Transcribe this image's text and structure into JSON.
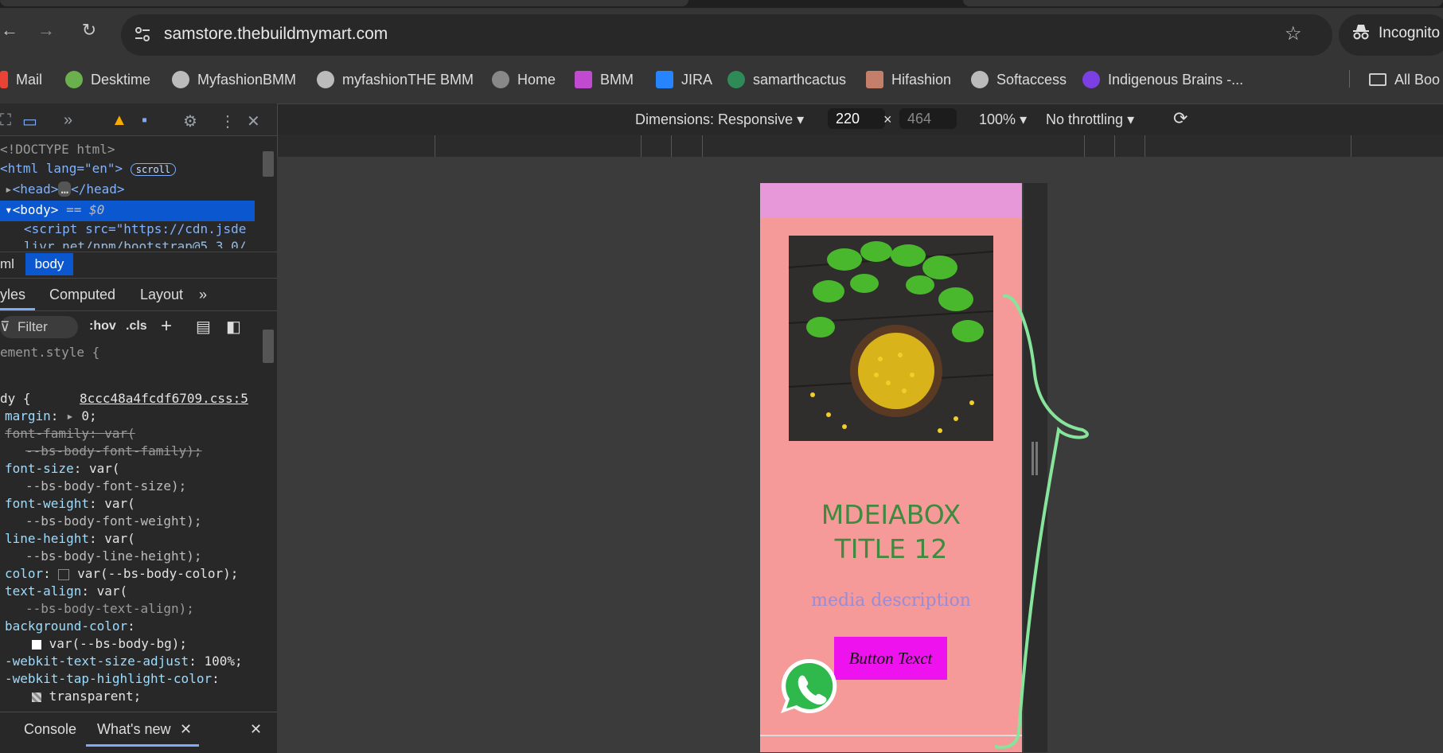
{
  "browser": {
    "url": "samstore.thebuildmymart.com",
    "profile_label": "Incognito",
    "bookmarks": [
      {
        "label": "Mail",
        "icon": "gmail-icon",
        "color": "#ea4335"
      },
      {
        "label": "Desktime",
        "icon": "desktime-icon",
        "color": "#6ab04c"
      },
      {
        "label": "MyfashionBMM",
        "icon": "globe-icon",
        "color": "#bbbbbb"
      },
      {
        "label": "myfashionTHE BMM",
        "icon": "globe-icon",
        "color": "#bbbbbb"
      },
      {
        "label": "Home",
        "icon": "globe-icon",
        "color": "#888888"
      },
      {
        "label": "BMM",
        "icon": "bmm-icon",
        "color": "#c04bd0"
      },
      {
        "label": "JIRA",
        "icon": "jira-icon",
        "color": "#2684ff"
      },
      {
        "label": "samarthcactus",
        "icon": "cactus-icon",
        "color": "#2e8b57"
      },
      {
        "label": "Hifashion",
        "icon": "hifashion-icon",
        "color": "#c47e6a"
      },
      {
        "label": "Softaccess",
        "icon": "globe-icon",
        "color": "#bbbbbb"
      },
      {
        "label": "Indigenous Brains -...",
        "icon": "indigenous-icon",
        "color": "#7b3fe4"
      }
    ],
    "all_bookmarks_label": "All Boo"
  },
  "devtools": {
    "dom": {
      "doctype": "<!DOCTYPE html>",
      "html_open": "<html lang=\"en\">",
      "scroll_badge": "scroll",
      "head": "<head>",
      "head_close": "</head>",
      "body": "<body>",
      "body_eq": "== $0",
      "script_line": "<script src=\"https://cdn.jsde",
      "script_line2": "livr.net/npm/bootstrap@5.3.0/"
    },
    "breadcrumbs": [
      "ml",
      "body"
    ],
    "style_tabs": [
      "yles",
      "Computed",
      "Layout"
    ],
    "filter_placeholder": "Filter",
    "filter_tools": [
      ":hov",
      ".cls"
    ],
    "rules": {
      "element_style": "ement.style {",
      "body_selector": "dy {",
      "source": "8ccc48a4fcdf6709.css:5",
      "lines": [
        {
          "prop": "margin",
          "value": "0;"
        },
        {
          "prop": "font-family",
          "value": "var(",
          "struck": true
        },
        {
          "prop": "",
          "value": "--bs-body-font-family);",
          "struck": true
        },
        {
          "prop": "font-size",
          "value": "var("
        },
        {
          "prop": "",
          "value": "--bs-body-font-size);"
        },
        {
          "prop": "font-weight",
          "value": "var("
        },
        {
          "prop": "",
          "value": "--bs-body-font-weight);"
        },
        {
          "prop": "line-height",
          "value": "var("
        },
        {
          "prop": "",
          "value": "--bs-body-line-height);"
        },
        {
          "prop": "color",
          "value": "var(--bs-body-color);"
        },
        {
          "prop": "text-align",
          "value": "var("
        },
        {
          "prop": "",
          "value": "--bs-body-text-align);"
        },
        {
          "prop": "background-color",
          "value": ""
        },
        {
          "prop": "",
          "value": "var(--bs-body-bg);"
        },
        {
          "prop": "-webkit-text-size-adjust",
          "value": "100%;"
        },
        {
          "prop": "-webkit-tap-highlight-color",
          "value": ""
        },
        {
          "prop": "",
          "value": "transparent;"
        }
      ]
    },
    "drawer_tabs": [
      "Console",
      "What's new"
    ]
  },
  "device_toolbar": {
    "dimensions_label": "Dimensions: Responsive",
    "width": "220",
    "height": "464",
    "times": "×",
    "zoom": "100%",
    "throttling": "No throttling"
  },
  "mobile_page": {
    "header_color": "#e798d9",
    "background_color": "#f59a98",
    "image_alt": "fenugreek seeds and leaves",
    "title_line1": "MDEIABOX",
    "title_line2": "TITLE 12",
    "description": "media description",
    "button_label": "Button Texct",
    "whatsapp_icon": "whatsapp-icon"
  }
}
